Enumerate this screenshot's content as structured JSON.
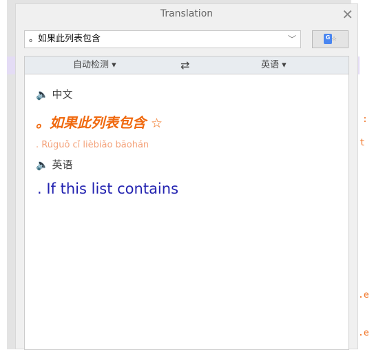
{
  "window": {
    "title": "Translation",
    "close_icon": "close-icon"
  },
  "input": {
    "value": "。如果此列表包含"
  },
  "translate_button": {
    "icon": "google-translate-icon",
    "logo_letter": "G"
  },
  "lang_bar": {
    "source": "自动检测 ▾",
    "swap": "⇄",
    "target": "英语 ▾"
  },
  "result": {
    "source_lang": "中文",
    "source_text": "。如果此列表包含",
    "pinyin": ". Rúguǒ cǐ lièbiǎo bāohán",
    "target_lang": "英语",
    "translation": ". If this list contains"
  },
  "background": {
    "right_letters": [
      ":",
      "t",
      ".e",
      ".e"
    ]
  },
  "colors": {
    "source": "#f06a10",
    "pinyin": "#f4a27a",
    "translation": "#2222b0"
  }
}
